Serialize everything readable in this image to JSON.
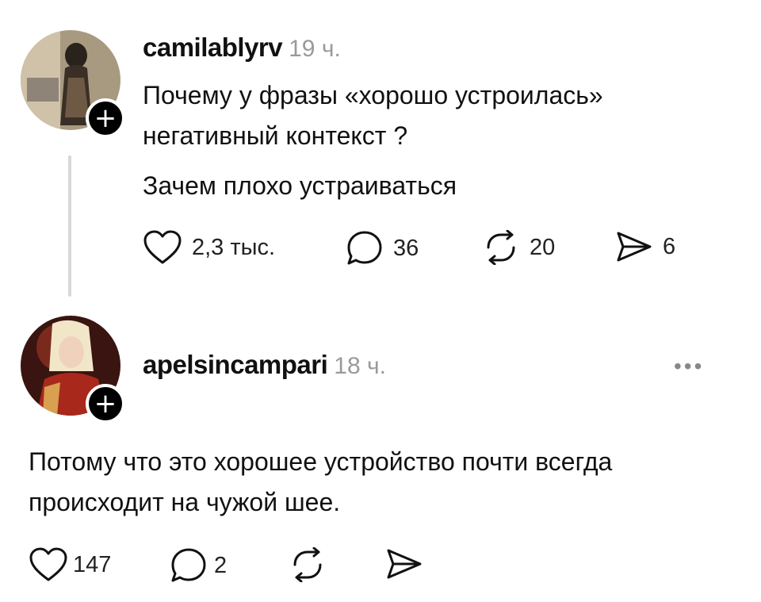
{
  "post": {
    "username": "camilablyrv",
    "time": "19 ч.",
    "text_line1": "Почему у фразы «хорошо устроилась»",
    "text_line2": "негативный контекст ?",
    "text_line3": "Зачем плохо устраиваться",
    "likes": "2,3 тыс.",
    "comments": "36",
    "reposts": "20",
    "shares": "6"
  },
  "reply": {
    "username": "apelsincampari",
    "time": "18 ч.",
    "more": "•••",
    "text_line1": "Потому что это хорошее устройство почти всегда",
    "text_line2": "происходит на чужой шее.",
    "likes": "147",
    "comments": "2"
  },
  "icons": {
    "plus": "+"
  }
}
